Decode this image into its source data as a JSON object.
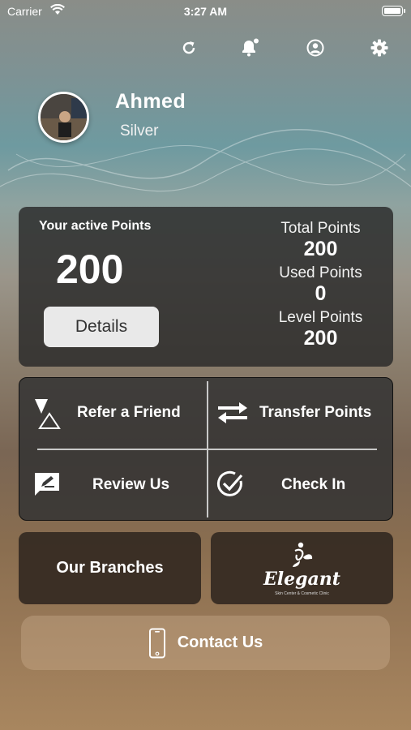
{
  "status_bar": {
    "carrier": "Carrier",
    "time": "3:27 AM"
  },
  "top_icons": [
    "refresh-icon",
    "bell-icon",
    "profile-icon",
    "gear-icon"
  ],
  "profile": {
    "name": "Ahmed",
    "tier": "Silver"
  },
  "points": {
    "active_label": "Your active Points",
    "active_value": "200",
    "details_label": "Details",
    "total_label": "Total Points",
    "total_value": "200",
    "used_label": "Used Points",
    "used_value": "0",
    "level_label": "Level Points",
    "level_value": "200"
  },
  "actions": {
    "refer": "Refer a Friend",
    "transfer": "Transfer Points",
    "review": "Review Us",
    "checkin": "Check In"
  },
  "tiles": {
    "branches": "Our Branches",
    "logo_text": "Elegant",
    "logo_sub": "Skin Center & Cosmetic Clinic"
  },
  "contact": {
    "label": "Contact Us"
  },
  "colors": {
    "card_dark": "#282828",
    "button_light": "#e9e9e9",
    "text": "#ffffff"
  }
}
